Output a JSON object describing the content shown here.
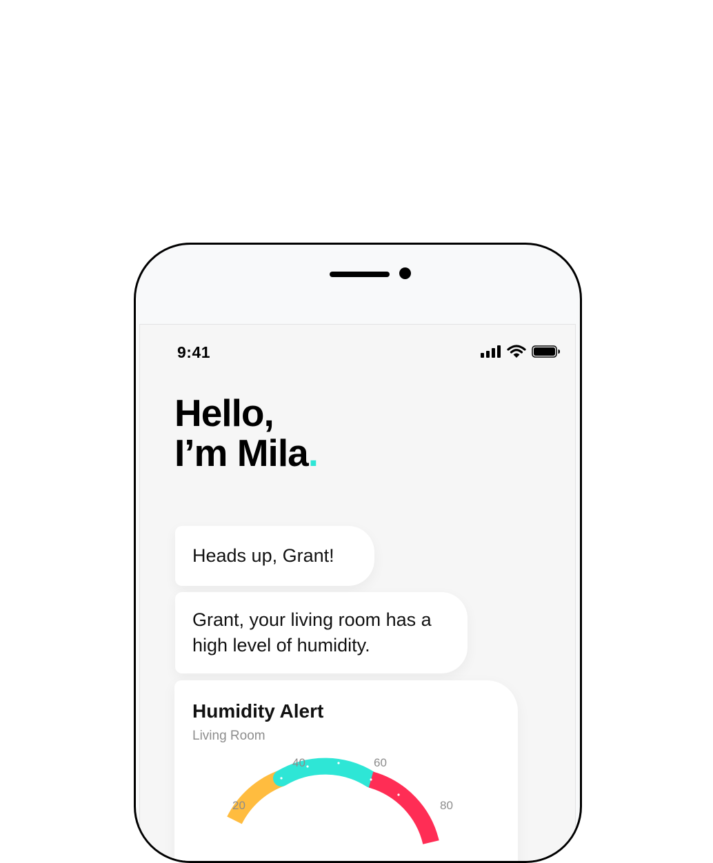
{
  "status_bar": {
    "time": "9:41",
    "icons": [
      "cellular-signal-icon",
      "wifi-icon",
      "battery-icon"
    ]
  },
  "greeting": {
    "line1": "Hello,",
    "line2": "I’m Mila",
    "accent_dot": ".",
    "accent_color": "#2ee6d6"
  },
  "messages": [
    {
      "text": "Heads up, Grant!"
    },
    {
      "text": "Grant, your living room has a high level of humidity."
    }
  ],
  "alert_card": {
    "title": "Humidity Alert",
    "subtitle": "Living Room",
    "gauge": {
      "tick_labels": [
        "20",
        "40",
        "60",
        "80"
      ],
      "segments": [
        {
          "name": "low",
          "color": "#ffbc3f"
        },
        {
          "name": "normal",
          "color": "#2ee6d6"
        },
        {
          "name": "high",
          "color": "#ff2d55"
        }
      ]
    }
  }
}
